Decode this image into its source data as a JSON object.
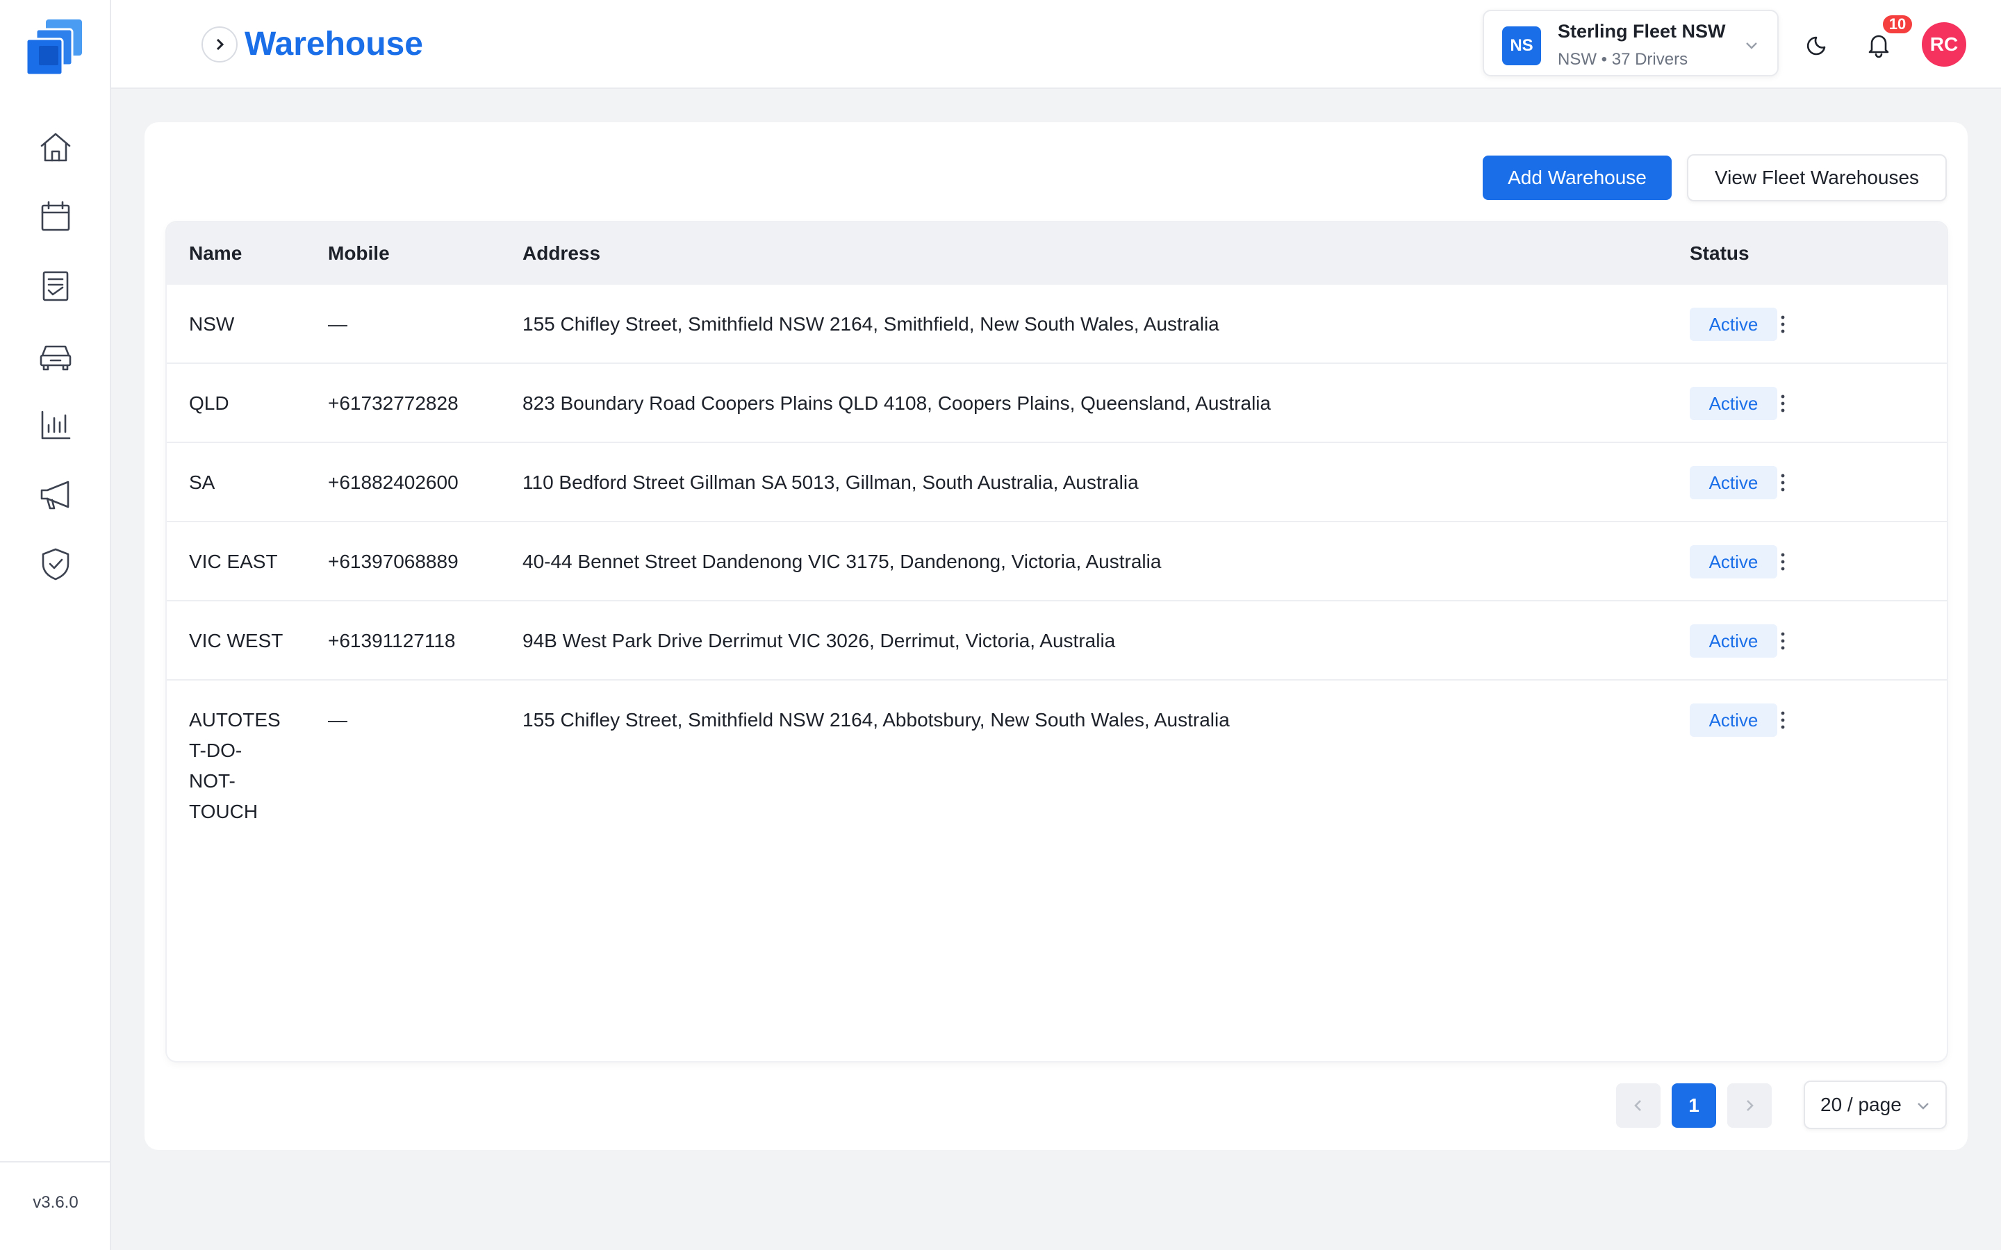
{
  "app": {
    "version": "v3.6.0",
    "brand_color": "#1a6fe8"
  },
  "sidebar": {
    "items": [
      {
        "name": "home-icon"
      },
      {
        "name": "calendar-icon"
      },
      {
        "name": "document-list-icon"
      },
      {
        "name": "car-icon"
      },
      {
        "name": "bar-chart-icon"
      },
      {
        "name": "megaphone-icon"
      },
      {
        "name": "shield-check-icon"
      }
    ]
  },
  "header": {
    "title": "Warehouse",
    "fleet": {
      "badge": "NS",
      "name": "Sterling Fleet NSW",
      "subtitle": "NSW • 37 Drivers"
    },
    "notifications_count": "10",
    "avatar_initials": "RC",
    "avatar_color": "#f5315e"
  },
  "toolbar": {
    "add_label": "Add Warehouse",
    "view_label": "View Fleet Warehouses"
  },
  "table": {
    "columns": {
      "name": "Name",
      "mobile": "Mobile",
      "address": "Address",
      "status": "Status"
    },
    "rows": [
      {
        "name": "NSW",
        "mobile": "—",
        "address": "155 Chifley Street, Smithfield NSW 2164, Smithfield, New South Wales, Australia",
        "status": "Active"
      },
      {
        "name": "QLD",
        "mobile": "+61732772828",
        "address": "823 Boundary Road Coopers Plains QLD 4108, Coopers Plains, Queensland, Australia",
        "status": "Active"
      },
      {
        "name": "SA",
        "mobile": "+61882402600",
        "address": "110 Bedford Street Gillman SA 5013, Gillman, South Australia, Australia",
        "status": "Active"
      },
      {
        "name": "VIC EAST",
        "mobile": "+61397068889",
        "address": "40-44 Bennet Street Dandenong VIC 3175, Dandenong, Victoria, Australia",
        "status": "Active"
      },
      {
        "name": "VIC WEST",
        "mobile": "+61391127118",
        "address": "94B West Park Drive Derrimut VIC 3026, Derrimut, Victoria, Australia",
        "status": "Active"
      },
      {
        "name": "AUTOTES T-DO- NOT- TOUCH",
        "name_lines": [
          "AUTOTES",
          "T-DO-",
          "NOT-",
          "TOUCH"
        ],
        "mobile": "—",
        "address": "155 Chifley Street, Smithfield NSW 2164, Abbotsbury, New South Wales, Australia",
        "status": "Active"
      }
    ]
  },
  "pagination": {
    "current_page": "1",
    "page_size": "20 / page"
  }
}
